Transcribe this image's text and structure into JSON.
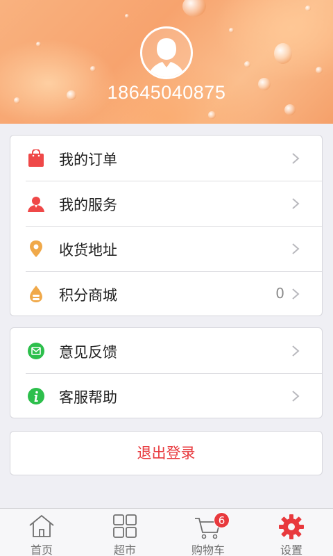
{
  "header": {
    "phone": "18645040875"
  },
  "menu_group_1": [
    {
      "icon": "shopping-bag-icon",
      "label": "我的订单",
      "value": ""
    },
    {
      "icon": "person-service-icon",
      "label": "我的服务",
      "value": ""
    },
    {
      "icon": "location-pin-icon",
      "label": "收货地址",
      "value": ""
    },
    {
      "icon": "points-coin-icon",
      "label": "积分商城",
      "value": "0"
    }
  ],
  "menu_group_2": [
    {
      "icon": "feedback-mail-icon",
      "label": "意见反馈"
    },
    {
      "icon": "info-help-icon",
      "label": "客服帮助"
    }
  ],
  "logout_label": "退出登录",
  "tabbar": {
    "tabs": [
      {
        "label": "首页",
        "icon": "home-icon"
      },
      {
        "label": "超市",
        "icon": "grid-icon"
      },
      {
        "label": "购物车",
        "icon": "cart-icon",
        "badge": "6"
      },
      {
        "label": "设置",
        "icon": "gear-icon"
      }
    ]
  },
  "colors": {
    "accent_red": "#e8393d",
    "pin_orange": "#f0a94a",
    "green": "#2dbf4c"
  }
}
